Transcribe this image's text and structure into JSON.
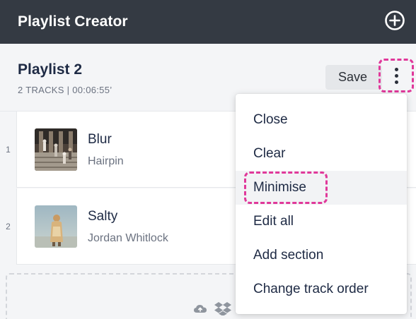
{
  "header": {
    "title": "Playlist Creator",
    "add_icon": "plus-circle-icon"
  },
  "playlist": {
    "name": "Playlist 2",
    "meta": "2 TRACKS | 00:06:55’",
    "save_label": "Save",
    "more_icon": "more-vertical-icon"
  },
  "tracks": [
    {
      "number": "1",
      "title": "Blur",
      "artist": "Hairpin"
    },
    {
      "number": "2",
      "title": "Salty",
      "artist": "Jordan Whitlock"
    }
  ],
  "upload": {
    "icons": [
      "cloud-upload-icon",
      "dropbox-icon"
    ]
  },
  "menu": {
    "items": [
      {
        "label": "Close"
      },
      {
        "label": "Clear"
      },
      {
        "label": "Minimise",
        "highlighted": true
      },
      {
        "label": "Edit all"
      },
      {
        "label": "Add section"
      },
      {
        "label": "Change track order"
      }
    ]
  },
  "colors": {
    "header_bg": "#343a43",
    "accent_highlight": "#e0389a",
    "text_primary": "#1e2a44",
    "text_secondary": "#6b7280"
  }
}
